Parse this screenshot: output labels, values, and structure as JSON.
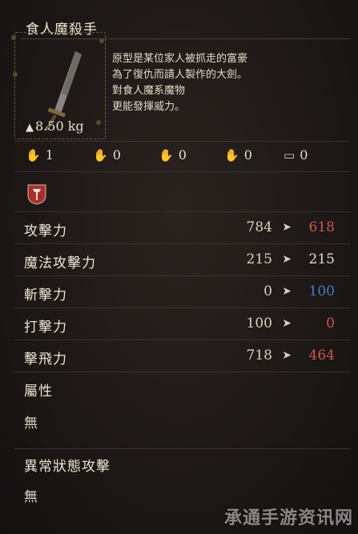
{
  "item": {
    "name": "食人魔殺手",
    "weight": "8.50 kg",
    "description": [
      "原型是某位家人被抓走的富豪",
      "為了復仇而請人製作的大劍。",
      "對食人魔系魔物",
      "更能發揮威力。"
    ]
  },
  "elements": [
    {
      "icon": "fire-hand-icon",
      "value": "1",
      "color": "#c2564c"
    },
    {
      "icon": "ice-hand-icon",
      "value": "0",
      "color": "#4e79c9"
    },
    {
      "icon": "thunder-hand-icon",
      "value": "0",
      "color": "#a07858"
    },
    {
      "icon": "holy-hand-icon",
      "value": "0",
      "color": "#b08a60"
    },
    {
      "icon": "dark-chest-icon",
      "value": "0",
      "color": "#cfcfcf"
    }
  ],
  "stats": [
    {
      "label": "攻擊力",
      "current": "784",
      "new": "618",
      "color": "#d2574b"
    },
    {
      "label": "魔法攻擊力",
      "current": "215",
      "new": "215",
      "color": "#e4dccb"
    },
    {
      "label": "斬擊力",
      "current": "0",
      "new": "100",
      "color": "#4b78cc"
    },
    {
      "label": "打擊力",
      "current": "100",
      "new": "0",
      "color": "#d2574b"
    },
    {
      "label": "擊飛力",
      "current": "718",
      "new": "464",
      "color": "#d2574b"
    }
  ],
  "attribute": {
    "label": "屬性",
    "value": "無"
  },
  "abnormal": {
    "label": "異常狀態攻擊",
    "value": "無"
  },
  "watermark": "承通手游资讯网"
}
